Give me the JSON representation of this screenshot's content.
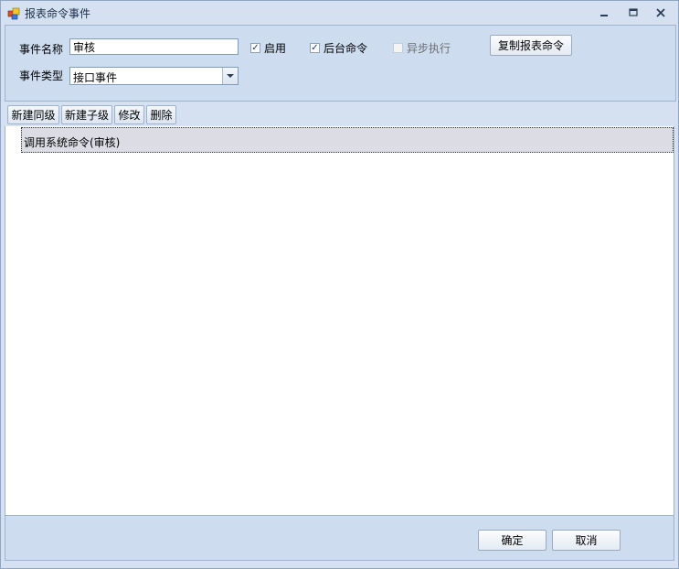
{
  "window": {
    "title": "报表命令事件",
    "icon": "app-icon"
  },
  "form": {
    "event_name_label": "事件名称",
    "event_name_value": "审核",
    "event_type_label": "事件类型",
    "event_type_value": "接口事件",
    "enable_label": "启用",
    "enable_checked": true,
    "background_label": "后台命令",
    "background_checked": true,
    "async_label": "异步执行",
    "async_checked": false,
    "copy_button_label": "复制报表命令"
  },
  "toolbar": {
    "new_sibling": "新建同级",
    "new_child": "新建子级",
    "edit": "修改",
    "delete": "删除"
  },
  "tree": {
    "items": [
      {
        "label": "调用系统命令(审核)",
        "selected": true
      }
    ]
  },
  "footer": {
    "ok_label": "确定",
    "cancel_label": "取消"
  },
  "colors": {
    "window_bg": "#d5e1f0",
    "panel_bg": "#cddcef",
    "border": "#9db3cf",
    "selected_row": "#dcdde4"
  }
}
